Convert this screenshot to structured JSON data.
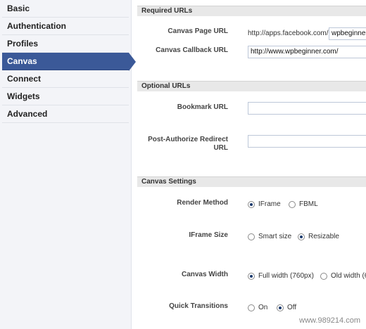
{
  "sidebar": {
    "items": [
      {
        "label": "Basic"
      },
      {
        "label": "Authentication"
      },
      {
        "label": "Profiles"
      },
      {
        "label": "Canvas"
      },
      {
        "label": "Connect"
      },
      {
        "label": "Widgets"
      },
      {
        "label": "Advanced"
      }
    ],
    "active_index": 3
  },
  "required_urls": {
    "header": "Required URLs",
    "canvas_page_url": {
      "label": "Canvas Page URL",
      "prefix": "http://apps.facebook.com/",
      "value": "wpbeginner"
    },
    "canvas_callback_url": {
      "label": "Canvas Callback URL",
      "value": "http://www.wpbeginner.com/"
    }
  },
  "optional_urls": {
    "header": "Optional URLs",
    "bookmark_url": {
      "label": "Bookmark URL",
      "value": ""
    },
    "post_authorize_redirect_url": {
      "label_line1": "Post-Authorize Redirect",
      "label_line2": "URL",
      "value": ""
    }
  },
  "canvas_settings": {
    "header": "Canvas Settings",
    "render_method": {
      "label": "Render Method",
      "options": [
        {
          "label": "IFrame",
          "checked": true
        },
        {
          "label": "FBML",
          "checked": false
        }
      ]
    },
    "iframe_size": {
      "label": "IFrame Size",
      "options": [
        {
          "label": "Smart size",
          "checked": false
        },
        {
          "label": "Resizable",
          "checked": true
        }
      ]
    },
    "canvas_width": {
      "label": "Canvas Width",
      "options": [
        {
          "label": "Full width (760px)",
          "checked": true
        },
        {
          "label": "Old width (6",
          "checked": false
        }
      ]
    },
    "quick_transitions": {
      "label": "Quick Transitions",
      "options": [
        {
          "label": "On",
          "checked": false
        },
        {
          "label": "Off",
          "checked": true
        }
      ]
    }
  },
  "watermark": "www.989214.com"
}
